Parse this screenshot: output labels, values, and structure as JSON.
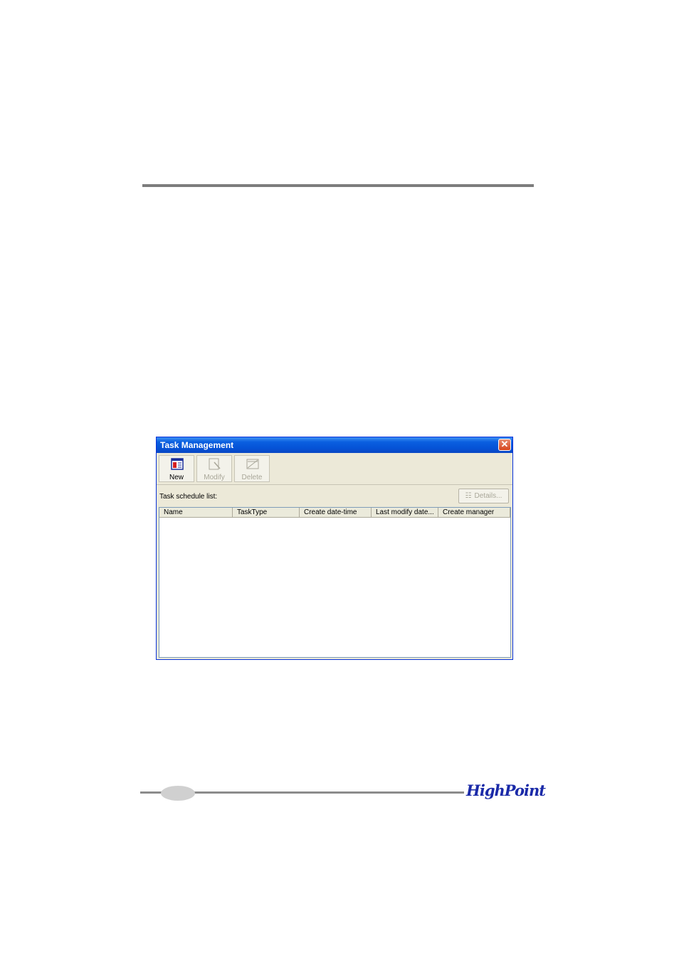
{
  "window": {
    "title": "Task Management",
    "close_glyph": "✕"
  },
  "toolbar": {
    "new_label": "New",
    "modify_label": "Modify",
    "delete_label": "Delete"
  },
  "list": {
    "label": "Task schedule list:",
    "details_label": "Details...",
    "columns": [
      "Name",
      "TaskType",
      "Create date-time",
      "Last modify date...",
      "Create manager"
    ]
  },
  "footer": {
    "logo_text": "HighPoint"
  },
  "colors": {
    "titlebar": "#0552d6",
    "close": "#d5451e",
    "window_bg": "#ece9d8",
    "logo": "#1a2aa8"
  },
  "icons": [
    "new-task-icon",
    "modify-task-icon",
    "delete-task-icon",
    "details-icon",
    "close-icon"
  ]
}
